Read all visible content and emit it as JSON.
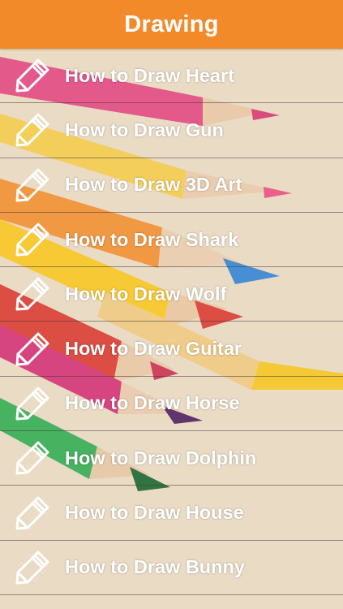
{
  "header": {
    "title": "Drawing"
  },
  "list": {
    "icon": "pencil-icon",
    "items": [
      {
        "label": "How to Draw Heart"
      },
      {
        "label": "How to Draw Gun"
      },
      {
        "label": "How to Draw 3D Art"
      },
      {
        "label": "How to Draw Shark"
      },
      {
        "label": "How to Draw Wolf"
      },
      {
        "label": "How to Draw Guitar"
      },
      {
        "label": "How to Draw Horse"
      },
      {
        "label": "How to Draw Dolphin"
      },
      {
        "label": "How to Draw House"
      },
      {
        "label": "How to Draw Bunny"
      }
    ]
  },
  "colors": {
    "header": "#f28a2a",
    "text": "#ffffff"
  }
}
